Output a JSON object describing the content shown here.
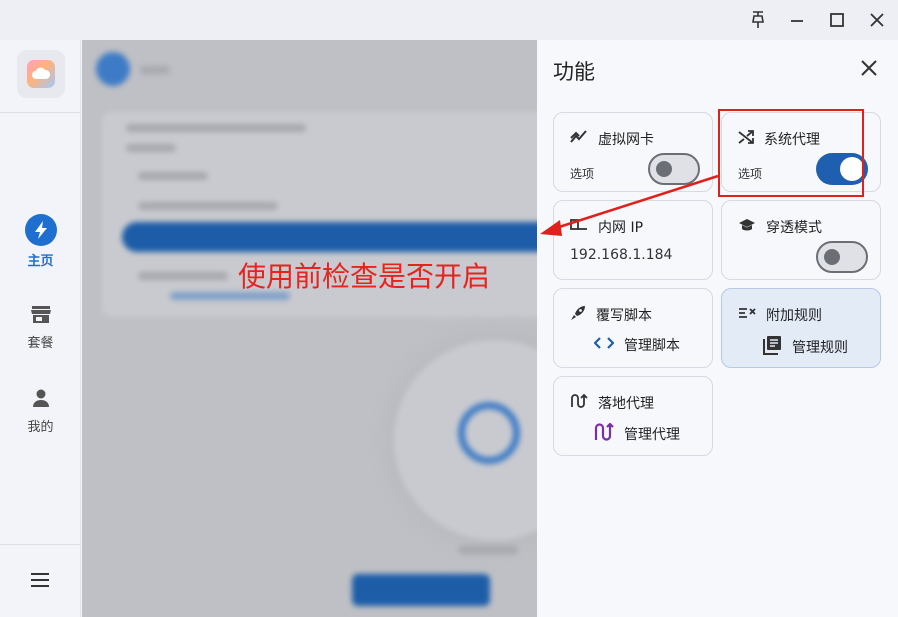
{
  "nav": {
    "items": [
      {
        "label": "主页",
        "icon": "lightning-icon",
        "active": true
      },
      {
        "label": "套餐",
        "icon": "store-icon",
        "active": false
      },
      {
        "label": "我的",
        "icon": "person-icon",
        "active": false
      }
    ],
    "menu_icon": "hamburger-icon"
  },
  "titlebar": {
    "buttons": [
      "pin-icon",
      "minimize-icon",
      "maximize-icon",
      "close-icon"
    ]
  },
  "annotation": {
    "text": "使用前检查是否开启",
    "color": "#e8231d"
  },
  "panel": {
    "title": "功能",
    "cards": {
      "virtual_nic": {
        "label": "虚拟网卡",
        "sub": "选项",
        "toggle": "off"
      },
      "system_proxy": {
        "label": "系统代理",
        "sub": "选项",
        "toggle": "on"
      },
      "lan_ip": {
        "label": "内网 IP",
        "value": "192.168.1.184"
      },
      "penetration": {
        "label": "穿透模式",
        "toggle": "off"
      },
      "override_script": {
        "label": "覆写脚本",
        "action": "管理脚本"
      },
      "extra_rules": {
        "label": "附加规则",
        "action": "管理规则"
      },
      "landing_proxy": {
        "label": "落地代理",
        "action": "管理代理"
      }
    }
  },
  "colors": {
    "accent": "#1f6fd1",
    "toggle_on": "#1f5fb0",
    "annotation_red": "#e2201b",
    "purple_icon": "#7a2fa8"
  }
}
